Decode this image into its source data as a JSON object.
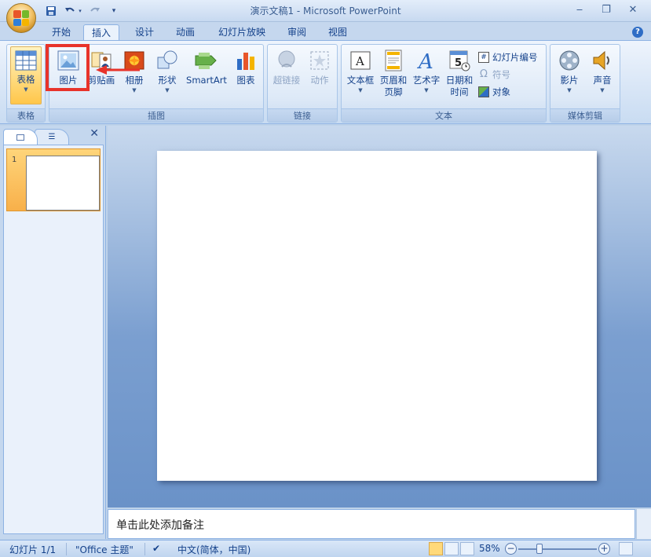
{
  "window": {
    "title": "演示文稿1 - Microsoft PowerPoint",
    "controls": [
      "‒",
      "❐",
      "✕"
    ]
  },
  "qat": [
    "save-icon",
    "undo-icon",
    "redo-icon",
    "customize-icon"
  ],
  "tabs": [
    {
      "label": "开始"
    },
    {
      "label": "插入",
      "active": true
    },
    {
      "label": "设计"
    },
    {
      "label": "动画"
    },
    {
      "label": "幻灯片放映"
    },
    {
      "label": "审阅"
    },
    {
      "label": "视图"
    }
  ],
  "ribbon": {
    "groups": {
      "table": "表格",
      "illustrations": "插图",
      "links": "链接",
      "text": "文本",
      "media": "媒体剪辑"
    },
    "buttons": {
      "table": "表格",
      "picture": "图片",
      "clipart": "剪贴画",
      "album": "相册",
      "shapes": "形状",
      "smartart": "SmartArt",
      "chart": "图表",
      "hyperlink": "超链接",
      "action": "动作",
      "textbox": "文本框",
      "header_footer_1": "页眉和",
      "header_footer_2": "页脚",
      "wordart": "艺术字",
      "datetime_1": "日期和",
      "datetime_2": "时间",
      "slide_number": "幻灯片编号",
      "symbol": "符号",
      "object": "对象",
      "movie": "影片",
      "sound": "声音"
    }
  },
  "slides_panel": {
    "slide_number": "1"
  },
  "notes": {
    "placeholder": "单击此处添加备注"
  },
  "statusbar": {
    "slide": "幻灯片 1/1",
    "theme": "\"Office 主题\"",
    "language": "中文(简体，中国)",
    "zoom": "58%"
  },
  "colors": {
    "accent_highlight": "#e8332a",
    "ribbon_bg": "#dde9f7",
    "workspace_bg": "#7b9fd0"
  }
}
